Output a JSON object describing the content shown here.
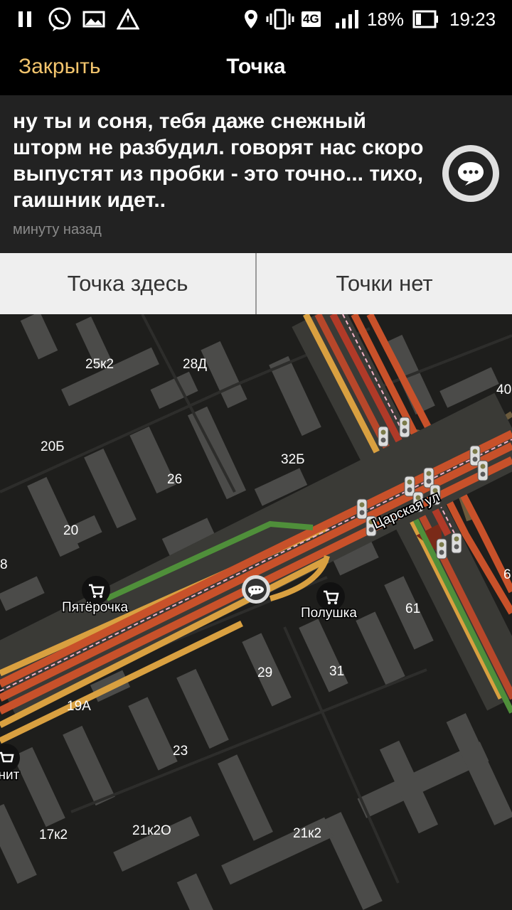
{
  "status_bar": {
    "battery": "18%",
    "time": "19:23",
    "network": "4G",
    "icons": [
      "pause-icon",
      "viber-icon",
      "image-icon",
      "warning-icon",
      "location-icon",
      "vibrate-icon",
      "network-4g-icon",
      "signal-icon",
      "battery-icon"
    ]
  },
  "header": {
    "close_label": "Закрыть",
    "title": "Точка"
  },
  "message": {
    "text": "ну ты и соня, тебя даже снежный шторм не разбудил. говорят нас скоро выпустят из пробки - это точно... тихо, гаишник идет..",
    "time": "минуту назад",
    "icon": "chat-bubble-icon"
  },
  "actions": {
    "here_label": "Точка здесь",
    "not_label": "Точки нет"
  },
  "map": {
    "street_name": "Царская ул",
    "labels": [
      "25к2",
      "28Д",
      "40",
      "20Б",
      "32Б",
      "26",
      "20",
      "8",
      "6",
      "61",
      "29",
      "31",
      "19А",
      "23",
      "17к2",
      "21к2О",
      "21к2"
    ],
    "pois": [
      "Пятёрочка",
      "Полушка",
      "Магнит"
    ],
    "colors": {
      "background": "#1e1e1c",
      "building": "#4b4b49",
      "jam_heavy": "#c8512a",
      "jam_slow": "#d9a040",
      "free": "#4f8f3a",
      "accent": "#f2c46d"
    }
  }
}
